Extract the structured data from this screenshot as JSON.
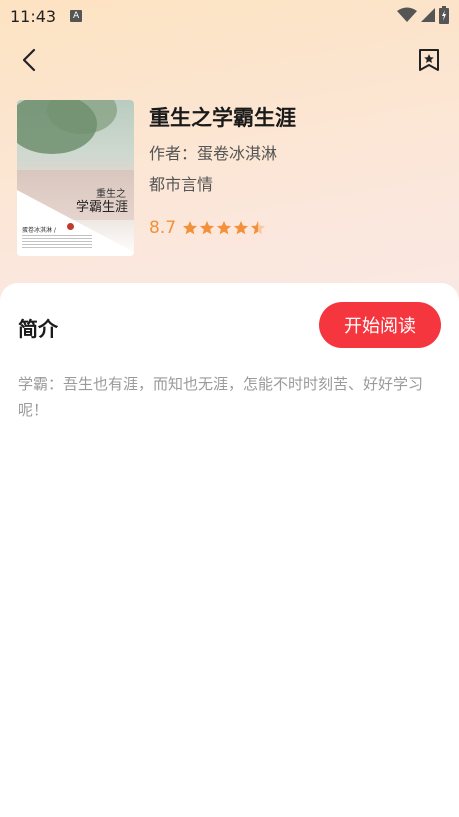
{
  "status_bar": {
    "time": "11:43",
    "notification_icon": "a-icon",
    "icons": [
      "wifi-icon",
      "signal-icon",
      "battery-icon"
    ]
  },
  "topbar": {
    "back_icon": "chevron-left-icon",
    "bookmark_icon": "bookmark-star-icon"
  },
  "book": {
    "title": "重生之学霸生涯",
    "author": "作者：蛋卷冰淇淋",
    "category": "都市言情",
    "rating": "8.7",
    "stars_filled": 4.5,
    "stars_total": 5,
    "cover": {
      "title_line1": "重生之",
      "title_line2": "学霸生涯",
      "author": "蛋卷冰淇淋 /"
    }
  },
  "intro": {
    "heading": "简介",
    "start_button": "开始阅读",
    "text": "学霸：吾生也有涯，而知也无涯，怎能不时时刻苦、好好学习呢！"
  },
  "colors": {
    "accent": "#f6363f",
    "rating": "#f2913a",
    "intro_text": "#9a9a9a"
  }
}
